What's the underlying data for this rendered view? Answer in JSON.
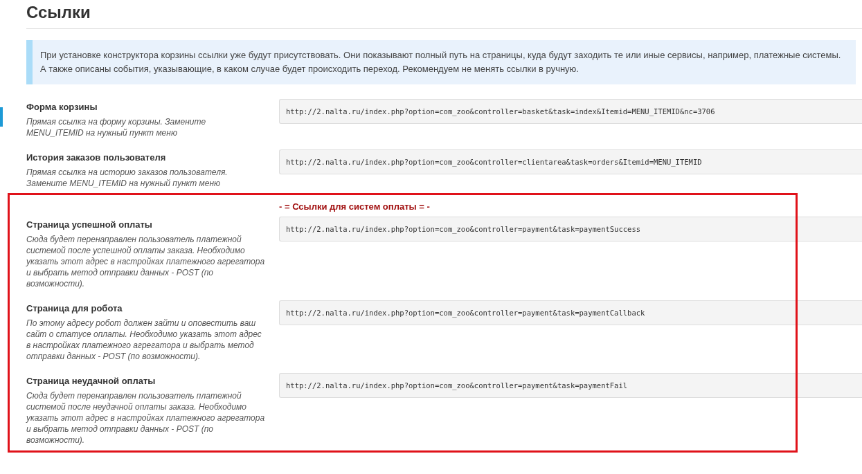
{
  "page": {
    "title": "Ссылки"
  },
  "notice": "При установке конструктора корзины ссылки уже будут присутствовать. Они показывают полный путь на страницы, куда будут заходить те или иные сервисы, например, платежные системы. А также описаны события, указывающие, в каком случае будет происходить переход. Рекомендуем не менять ссылки в ручную.",
  "groups": [
    {
      "highlighted": false,
      "fields": [
        {
          "label": "Форма корзины",
          "description": "Прямая ссылка на форму корзины. Замените MENU_ITEMID на нужный пункт меню",
          "value": "http://2.nalta.ru/index.php?option=com_zoo&controller=basket&task=index&Itemid=MENU_ITEMID&nc=3706"
        },
        {
          "label": "История заказов пользователя",
          "description": "Прямая ссылка на историю заказов пользователя. Замените MENU_ITEMID на нужный пункт меню",
          "value": "http://2.nalta.ru/index.php?option=com_zoo&controller=clientarea&task=orders&Itemid=MENU_ITEMID"
        }
      ]
    },
    {
      "highlighted": true,
      "heading": "- = Ссылки для систем оплаты = -",
      "fields": [
        {
          "label": "Страница успешной оплаты",
          "description": "Сюда будет перенаправлен пользователь платежной системой после успешной оплаты заказа. Необходимо указать этот адрес в настройках платежного агрегатора и выбрать метод отправки данных - POST (по возможности).",
          "value": "http://2.nalta.ru/index.php?option=com_zoo&controller=payment&task=paymentSuccess"
        },
        {
          "label": "Страница для робота",
          "description": "По этому адресу робот должен зайти и оповестить ваш сайт о статусе оплаты. Необходимо указать этот адрес в настройках платежного агрегатора и выбрать метод отправки данных - POST (по возможности).",
          "value": "http://2.nalta.ru/index.php?option=com_zoo&controller=payment&task=paymentCallback"
        },
        {
          "label": "Страница неудачной оплаты",
          "description": "Сюда будет перенаправлен пользователь платежной системой после неудачной оплаты заказа. Необходимо указать этот адрес в настройках платежного агрегатора и выбрать метод отправки данных - POST (по возможности).",
          "value": "http://2.nalta.ru/index.php?option=com_zoo&controller=payment&task=paymentFail"
        }
      ]
    }
  ]
}
